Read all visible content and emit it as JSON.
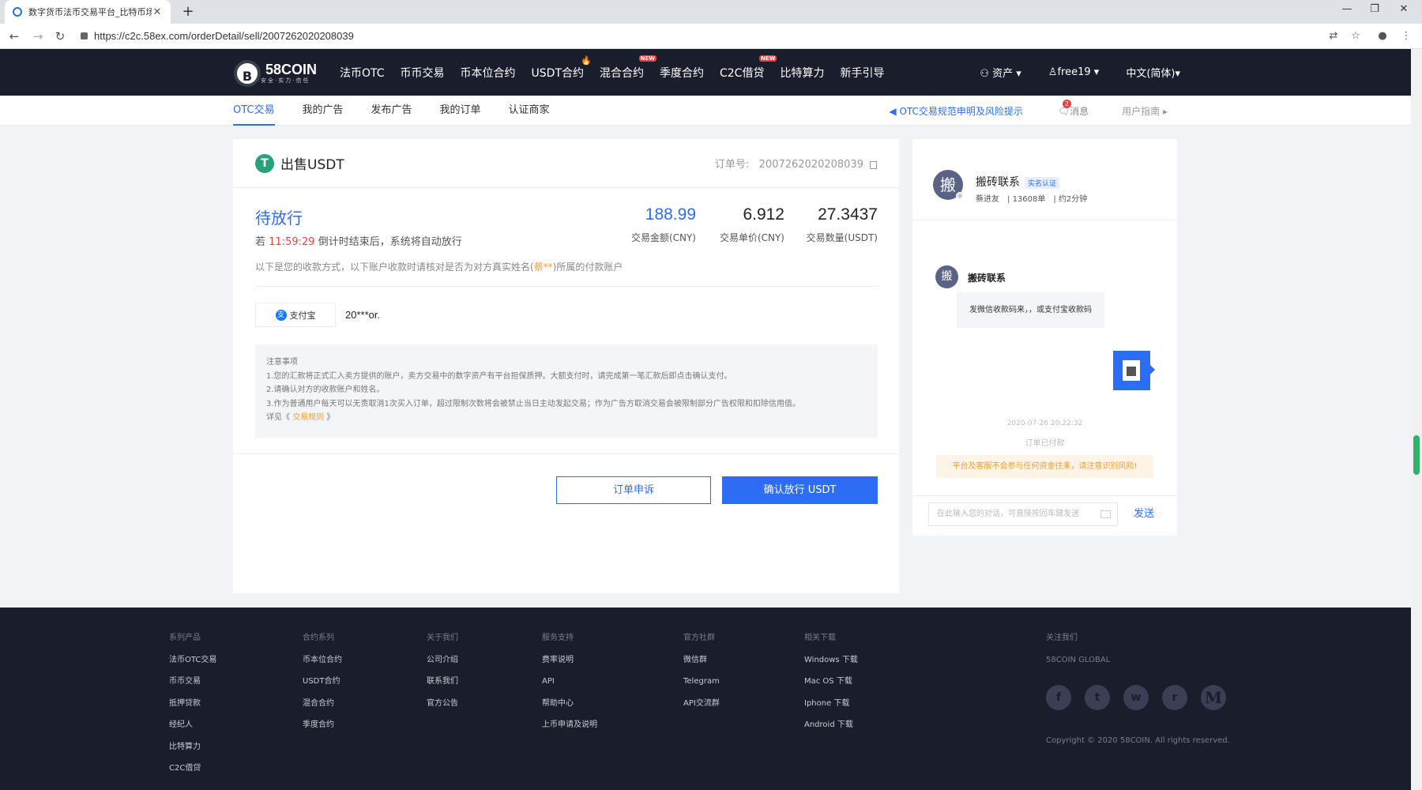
{
  "browser": {
    "tab_title": "数字货币法币交易平台_比特币场",
    "url": "https://c2c.58ex.com/orderDetail/sell/2007262020208039"
  },
  "header": {
    "brand": "58COIN",
    "brand_tag": "安全·实力·信任",
    "nav": [
      {
        "label": "法币OTC",
        "badge": ""
      },
      {
        "label": "币币交易",
        "badge": ""
      },
      {
        "label": "币本位合约",
        "badge": ""
      },
      {
        "label": "USDT合约",
        "badge": "hot"
      },
      {
        "label": "混合合约",
        "badge": "NEW"
      },
      {
        "label": "季度合约",
        "badge": ""
      },
      {
        "label": "C2C借贷",
        "badge": "NEW"
      },
      {
        "label": "比特算力",
        "badge": ""
      },
      {
        "label": "新手引导",
        "badge": ""
      }
    ],
    "assets": "资产",
    "user": "free19",
    "language": "中文(简体)"
  },
  "subnav": {
    "tabs": [
      "OTC交易",
      "我的广告",
      "发布广告",
      "我的订单",
      "认证商家"
    ],
    "active_index": 0,
    "notice": "OTC交易规范申明及风险提示",
    "messages": "消息",
    "message_count": "2",
    "guide": "用户指南"
  },
  "order": {
    "title": "出售USDT",
    "order_no_label": "订单号:",
    "order_no": "2007262020208039",
    "status": "待放行",
    "countdown_prefix": "若",
    "countdown": "11:59:29",
    "countdown_suffix": "倒计时结束后，系统将自动放行",
    "amount": "188.99",
    "amount_label": "交易金额(CNY)",
    "price": "6.912",
    "price_label": "交易单价(CNY)",
    "quantity": "27.3437",
    "quantity_label": "交易数量(USDT)",
    "pay_hint_a": "以下是您的收款方式，以下账户收款时请核对是否为对方真实姓名(",
    "pay_hint_name": "蔡**",
    "pay_hint_b": ")所属的付款账户",
    "pay_method": "支付宝",
    "pay_account": "20***or.",
    "notes_title": "注意事项",
    "notes": [
      "1.您的汇款将正式汇入卖方提供的账户，卖方交易中的数字资产有平台担保质押。大额支付时，请完成第一笔汇款后即点击确认支付。",
      "2.请确认对方的收款账户和姓名。",
      "3.作为普通用户每天可以无责取消1次买入订单，超过限制次数将会被禁止当日主动发起交易；作为广告方取消交易会被限制部分广告权限和扣除信用值。"
    ],
    "notes_more_prefix": "详见《",
    "notes_more_link": "交易规则",
    "notes_more_suffix": "》",
    "appeal_label": "订单申诉",
    "release_label": "确认放行 USDT"
  },
  "chat": {
    "avatar_char": "搬",
    "merchant": "搬砖联系",
    "verified": "实名认证",
    "real_name": "蔡进友",
    "orders": "13608单",
    "response": "约2分钟",
    "msg_sender": "搬砖联系",
    "msg_text": "发微信收款码来，，或支付宝收款码",
    "time": "2020-07-26 20:22:32",
    "system_msg": "订单已付款",
    "warning": "平台及客服不会参与任何资金往来，请注意识别风险!",
    "input_placeholder": "在此输入您的对话，可直接按回车键发送",
    "send_label": "发送"
  },
  "footer": {
    "columns": [
      {
        "title": "系列产品",
        "items": [
          "法币OTC交易",
          "币币交易",
          "抵押贷款",
          "经纪人",
          "比特算力",
          "C2C借贷"
        ]
      },
      {
        "title": "合约系列",
        "items": [
          "币本位合约",
          "USDT合约",
          "混合合约",
          "季度合约"
        ]
      },
      {
        "title": "关于我们",
        "items": [
          "公司介绍",
          "联系我们",
          "官方公告"
        ]
      },
      {
        "title": "服务支持",
        "items": [
          "费率说明",
          "API",
          "帮助中心",
          "上币申请及说明"
        ]
      },
      {
        "title": "官方社群",
        "items": [
          "微信群",
          "Telegram",
          "API交流群"
        ]
      },
      {
        "title": "相关下载",
        "items": [
          "Windows 下载",
          "Mac OS 下载",
          "Iphone 下载",
          "Android 下载"
        ]
      },
      {
        "title": "关注我们",
        "items": [
          "58COIN GLOBAL"
        ]
      }
    ],
    "social": [
      "facebook-icon",
      "twitter-icon",
      "weibo-icon",
      "reddit-icon",
      "medium-icon"
    ],
    "copyright": "Copyright © 2020 58COIN. All rights reserved."
  },
  "colors": {
    "accent": "#2d6df6",
    "header_bg": "#1a1d2b",
    "warning": "#f29d38",
    "danger": "#e64340"
  }
}
